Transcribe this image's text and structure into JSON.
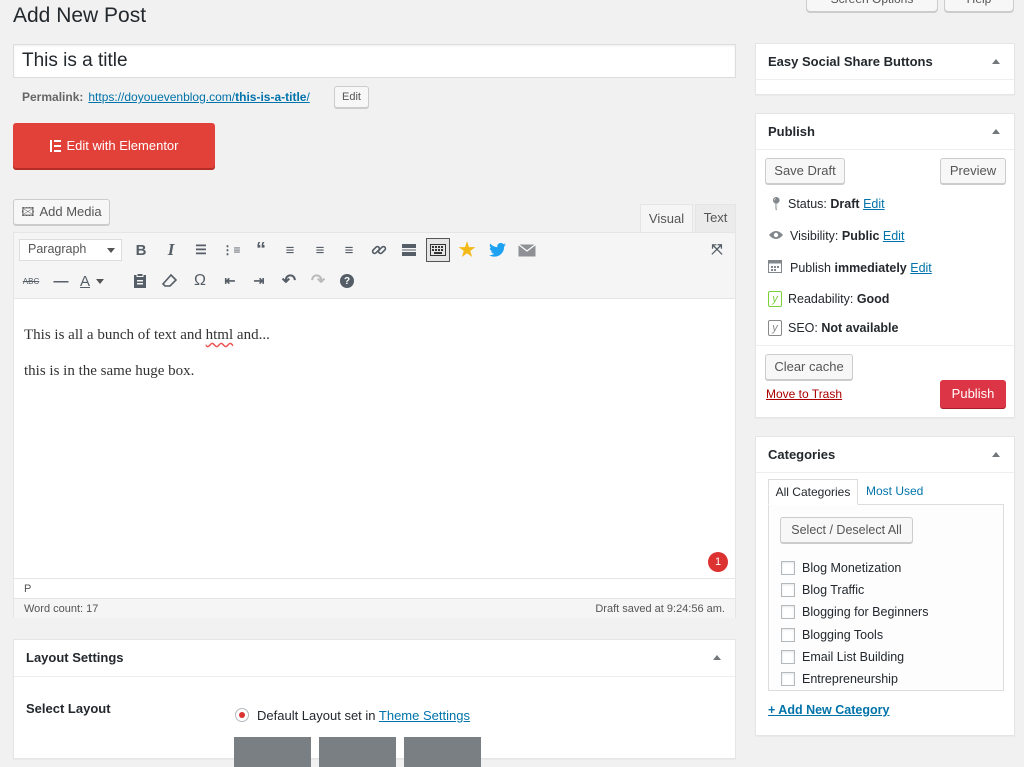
{
  "header": {
    "page_title": "Add New Post",
    "screen_options_label": "Screen Options",
    "help_label": "Help"
  },
  "post": {
    "title_value": "This is a title",
    "permalink_label": "Permalink:",
    "permalink_base": "https://doyouevenblog.com/",
    "permalink_slug": "this-is-a-title",
    "permalink_trailing": "/",
    "edit_label": "Edit",
    "elementor_label": "Edit with Elementor"
  },
  "editor": {
    "add_media_label": "Add Media",
    "tab_visual": "Visual",
    "tab_text": "Text",
    "paragraph_select": "Paragraph",
    "content_line1_a": "This is all a bunch of text and ",
    "content_line1_b": "html",
    "content_line1_c": " and...",
    "content_line2": "this is in the same huge box.",
    "notification_count": "1",
    "path": "P",
    "word_count": "Word count: 17",
    "draft_saved": "Draft saved at 9:24:56 am."
  },
  "layout_settings": {
    "title": "Layout Settings",
    "select_layout_label": "Select Layout",
    "default_layout_text": "Default Layout set in ",
    "theme_settings_link": "Theme Settings"
  },
  "easy_social": {
    "title": "Easy Social Share Buttons"
  },
  "publish": {
    "title": "Publish",
    "save_draft": "Save Draft",
    "preview": "Preview",
    "status_label": "Status:",
    "status_value": "Draft",
    "visibility_label": "Visibility:",
    "visibility_value": "Public",
    "publish_label": "Publish",
    "publish_value": "immediately",
    "readability_label": "Readability:",
    "readability_value": "Good",
    "seo_label": "SEO:",
    "seo_value": "Not available",
    "edit": "Edit",
    "clear_cache": "Clear cache",
    "move_to_trash": "Move to Trash",
    "publish_button": "Publish"
  },
  "categories": {
    "title": "Categories",
    "tab_all": "All Categories",
    "tab_most_used": "Most Used",
    "select_deselect": "Select / Deselect All",
    "items": [
      "Blog Monetization",
      "Blog Traffic",
      "Blogging for Beginners",
      "Blogging Tools",
      "Email List Building",
      "Entrepreneurship"
    ],
    "add_new": "+ Add New Category"
  },
  "colors": {
    "accent_link": "#0073aa",
    "elementor_red": "#e2413a",
    "publish_red": "#dc3545",
    "trash_red": "#a00"
  }
}
